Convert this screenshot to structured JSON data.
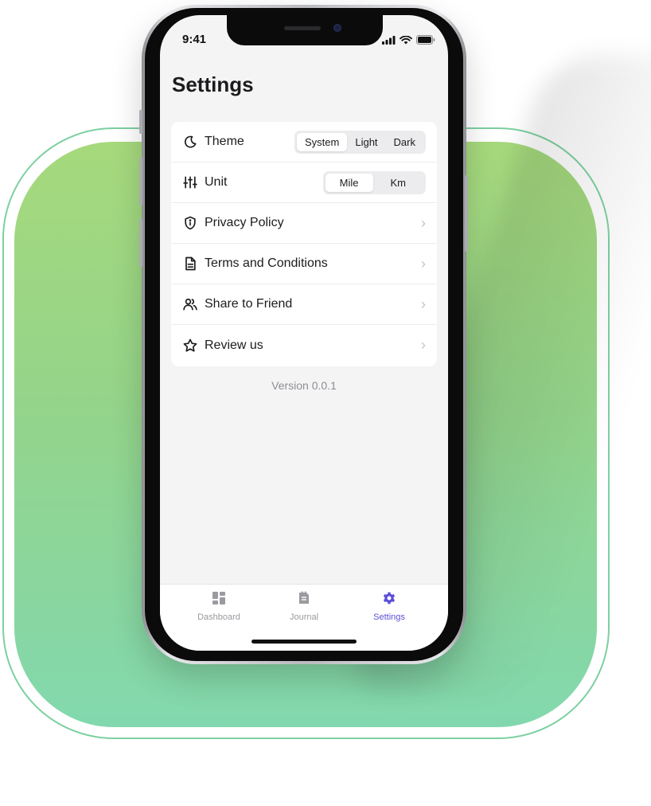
{
  "status": {
    "time": "9:41"
  },
  "page": {
    "title": "Settings"
  },
  "settings": {
    "theme": {
      "label": "Theme",
      "options": [
        "System",
        "Light",
        "Dark"
      ],
      "selected": "System"
    },
    "unit": {
      "label": "Unit",
      "options": [
        "Mile",
        "Km"
      ],
      "selected": "Mile"
    },
    "links": [
      {
        "label": "Privacy Policy",
        "icon": "shield-info-icon"
      },
      {
        "label": "Terms and Conditions",
        "icon": "document-icon"
      },
      {
        "label": "Share to Friend",
        "icon": "users-icon"
      },
      {
        "label": "Review us",
        "icon": "star-icon"
      }
    ]
  },
  "version": "Version 0.0.1",
  "tabbar": {
    "items": [
      {
        "label": "Dashboard",
        "icon": "dashboard-icon"
      },
      {
        "label": "Journal",
        "icon": "journal-icon"
      },
      {
        "label": "Settings",
        "icon": "gear-icon",
        "active": true
      }
    ]
  },
  "colors": {
    "accent": "#5b4fd6",
    "background_green_top": "#a6d97c",
    "background_green_bottom": "#82d8ae"
  }
}
